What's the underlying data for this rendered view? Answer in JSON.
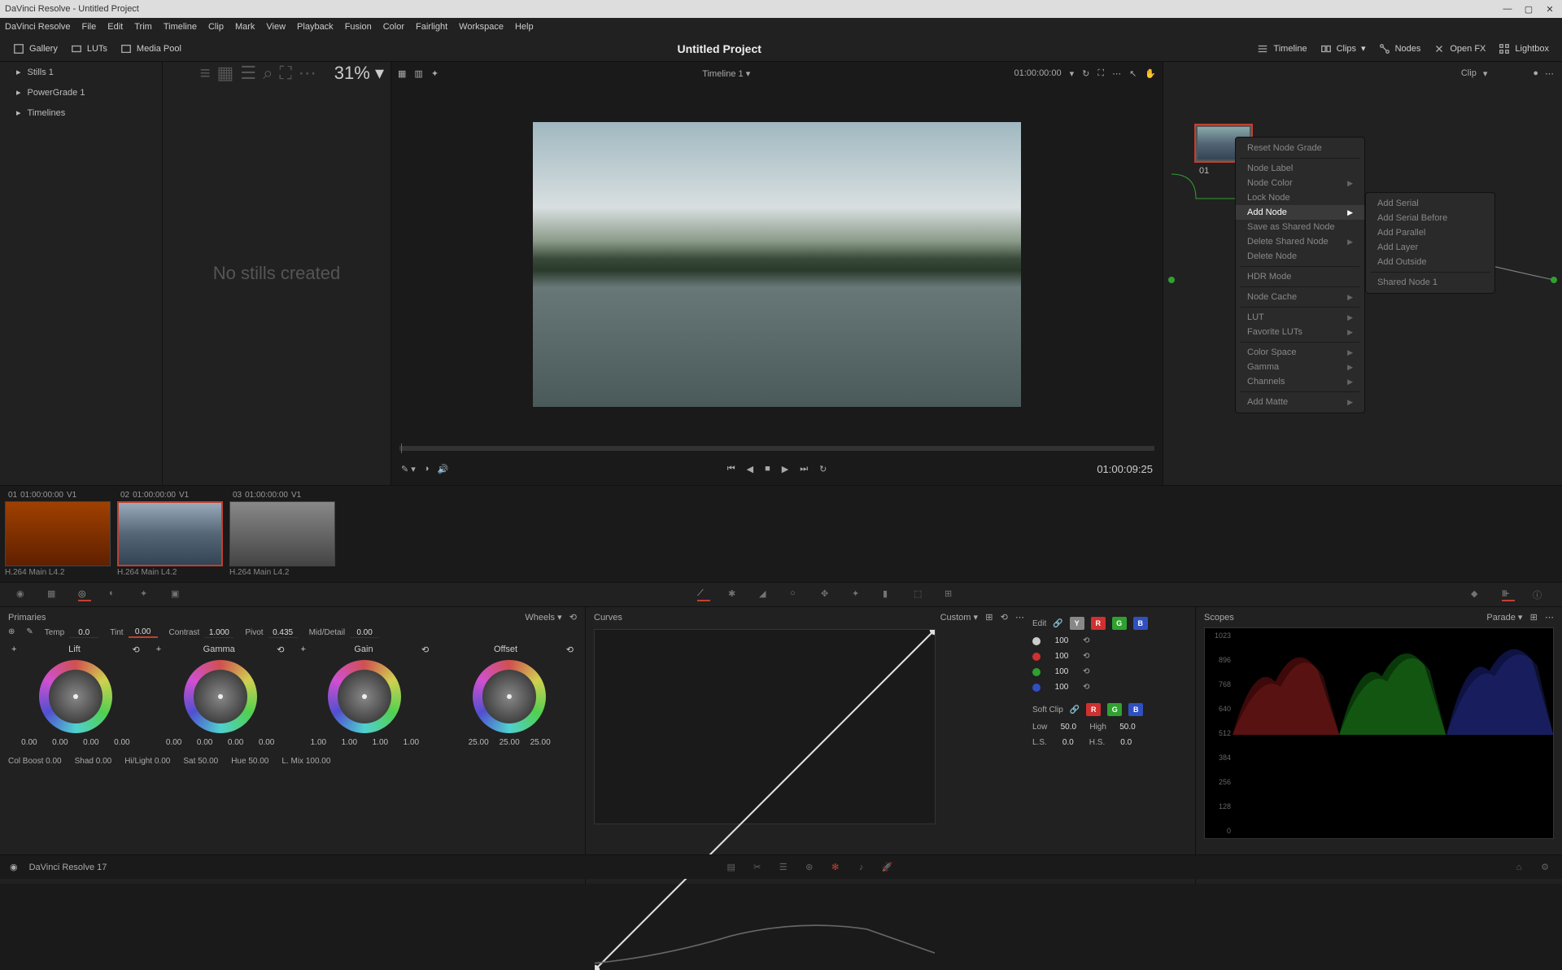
{
  "titlebar": "DaVinci Resolve - Untitled Project",
  "menu": [
    "DaVinci Resolve",
    "File",
    "Edit",
    "Trim",
    "Timeline",
    "Clip",
    "Mark",
    "View",
    "Playback",
    "Fusion",
    "Color",
    "Fairlight",
    "Workspace",
    "Help"
  ],
  "toolbar": {
    "gallery": "Gallery",
    "luts": "LUTs",
    "mediapool": "Media Pool",
    "timeline": "Timeline",
    "clips": "Clips",
    "nodes": "Nodes",
    "openfx": "Open FX",
    "lightbox": "Lightbox"
  },
  "project_title": "Untitled Project",
  "stills": {
    "tabs": [
      "Stills 1",
      "PowerGrade 1",
      "Timelines"
    ],
    "empty": "No stills created"
  },
  "viewer": {
    "timeline": "Timeline 1",
    "tc_in": "01:00:00:00",
    "tc_out": "01:00:09:25",
    "zoom": "31%"
  },
  "node_panel": {
    "mode": "Clip",
    "node_num": "01"
  },
  "context_menu": {
    "main": [
      "Reset Node Grade",
      "Node Label",
      "Node Color",
      "Lock Node",
      "Add Node",
      "Save as Shared Node",
      "Delete Shared Node",
      "Delete Node",
      "HDR Mode",
      "Node Cache",
      "LUT",
      "Favorite LUTs",
      "Color Space",
      "Gamma",
      "Channels",
      "Add Matte"
    ],
    "sub": [
      "Add Serial",
      "Add Serial Before",
      "Add Parallel",
      "Add Layer",
      "Add Outside",
      "Shared Node 1"
    ],
    "highlight": "Add Node"
  },
  "clips": [
    {
      "num": "01",
      "tc": "01:00:00:00",
      "track": "V1",
      "codec": "H.264 Main L4.2"
    },
    {
      "num": "02",
      "tc": "01:00:00:00",
      "track": "V1",
      "codec": "H.264 Main L4.2",
      "selected": true
    },
    {
      "num": "03",
      "tc": "01:00:00:00",
      "track": "V1",
      "codec": "H.264 Main L4.2"
    }
  ],
  "primaries": {
    "title": "Primaries",
    "wheels_label": "Wheels",
    "temp": {
      "label": "Temp",
      "val": "0.0"
    },
    "tint": {
      "label": "Tint",
      "val": "0.00"
    },
    "contrast": {
      "label": "Contrast",
      "val": "1.000"
    },
    "pivot": {
      "label": "Pivot",
      "val": "0.435"
    },
    "middetail": {
      "label": "Mid/Detail",
      "val": "0.00"
    },
    "wheels": [
      {
        "name": "Lift",
        "vals": [
          "0.00",
          "0.00",
          "0.00",
          "0.00"
        ]
      },
      {
        "name": "Gamma",
        "vals": [
          "0.00",
          "0.00",
          "0.00",
          "0.00"
        ]
      },
      {
        "name": "Gain",
        "vals": [
          "1.00",
          "1.00",
          "1.00",
          "1.00"
        ]
      },
      {
        "name": "Offset",
        "vals": [
          "25.00",
          "25.00",
          "25.00"
        ]
      }
    ],
    "bottom": {
      "colboost": {
        "label": "Col Boost",
        "val": "0.00"
      },
      "shad": {
        "label": "Shad",
        "val": "0.00"
      },
      "hilight": {
        "label": "Hi/Light",
        "val": "0.00"
      },
      "sat": {
        "label": "Sat",
        "val": "50.00"
      },
      "hue": {
        "label": "Hue",
        "val": "50.00"
      },
      "lmix": {
        "label": "L. Mix",
        "val": "100.00"
      }
    }
  },
  "curves": {
    "title": "Curves",
    "mode": "Custom",
    "edit": "Edit",
    "softclip": "Soft Clip",
    "channels": [
      {
        "dot": "#ccc",
        "val": "100"
      },
      {
        "dot": "#d03030",
        "val": "100"
      },
      {
        "dot": "#30a030",
        "val": "100"
      },
      {
        "dot": "#3050c0",
        "val": "100"
      }
    ],
    "low": {
      "label": "Low",
      "val": "50.0"
    },
    "high": {
      "label": "High",
      "val": "50.0"
    },
    "ls": {
      "label": "L.S.",
      "val": "0.0"
    },
    "hs": {
      "label": "H.S.",
      "val": "0.0"
    }
  },
  "scopes": {
    "title": "Scopes",
    "mode": "Parade",
    "ticks": [
      "1023",
      "896",
      "768",
      "640",
      "512",
      "384",
      "256",
      "128",
      "0"
    ]
  },
  "footer": {
    "app": "DaVinci Resolve 17"
  }
}
